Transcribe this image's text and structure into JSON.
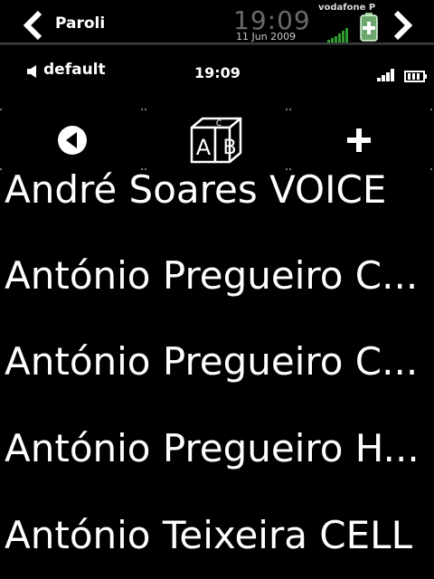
{
  "topbar": {
    "title": "Paroli",
    "clock": "19:09",
    "date": "11 Jun 2009",
    "operator": "vodafone P",
    "icons": [
      "chevron-left-icon",
      "chevron-right-icon",
      "signal-icon",
      "battery-icon"
    ]
  },
  "status": {
    "profile": "default",
    "time": "19:09",
    "icons": [
      "speaker-icon",
      "signal-icon",
      "battery-icon"
    ]
  },
  "toolbar": {
    "buttons": [
      "back-icon",
      "abc-cube-icon",
      "plus-icon"
    ],
    "cube_letters": [
      "A",
      "B",
      "C"
    ]
  },
  "contacts": [
    "André Soares VOICE",
    "António Pregueiro C...",
    "António Pregueiro C...",
    "António Pregueiro H...",
    "António Teixeira CELL"
  ],
  "colors": {
    "background": "#000000",
    "text": "#ffffff",
    "clock_gray": "#6a6a6a",
    "signal_green": "#2e9e2e"
  }
}
